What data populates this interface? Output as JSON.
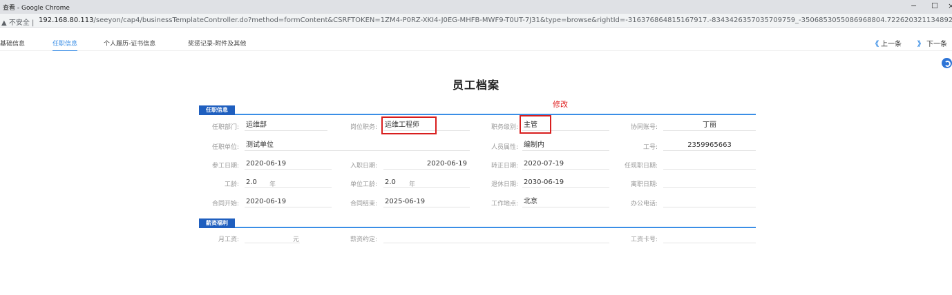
{
  "browser": {
    "window_title": "查看 - Google Chrome",
    "security_label": "不安全",
    "url_host": "192.168.80.113",
    "url_rest": "/seeyon/cap4/businessTemplateController.do?method=formContent&CSRFTOKEN=1ZM4-P0RZ-XKI4-J0EG-MHFB-MWF9-T0UT-7J31&type=browse&rightId=-316376864815167917.-8343426357035709759_-3506853055086968804.722620321134892."
  },
  "tabs": [
    "基础信息",
    "任职信息",
    "个人履历-证书信息",
    "奖惩记录-附件及其他"
  ],
  "active_tab": "任职信息",
  "pager": {
    "prev": "上一条",
    "next": "下一条"
  },
  "form": {
    "title": "员工档案",
    "edit_note": "修改",
    "section_job": "任职信息",
    "section_salary": "薪资福利",
    "fields": {
      "dept_label": "任职部门:",
      "dept": "运维部",
      "position_label": "岗位职务:",
      "position": "运维工程师",
      "level_label": "职务级别:",
      "level": "主管",
      "oa_label": "协同账号:",
      "oa": "丁丽",
      "unit_label": "任职单位:",
      "unit": "测试单位",
      "staff_type_label": "人员属性:",
      "staff_type": "编制内",
      "emp_no_label": "工号:",
      "emp_no": "2359965663",
      "work_start_label": "参工日期:",
      "work_start": "2020-06-19",
      "join_label": "入职日期:",
      "join": "2020-06-19",
      "regular_label": "转正日期:",
      "regular": "2020-07-19",
      "current_label": "任现职日期:",
      "current": "",
      "seniority_label": "工龄:",
      "seniority": "2.0",
      "seniority_unit": "年",
      "unit_seniority_label": "单位工龄:",
      "unit_seniority": "2.0",
      "unit_seniority_unit": "年",
      "retire_label": "退休日期:",
      "retire": "2030-06-19",
      "leave_label": "离职日期:",
      "leave": "",
      "contract_start_label": "合同开始:",
      "contract_start": "2020-06-19",
      "contract_end_label": "合同结束:",
      "contract_end": "2025-06-19",
      "location_label": "工作地点:",
      "location": "北京",
      "phone_label": "办公电话:",
      "phone": "",
      "salary_label": "月工资:",
      "salary": "",
      "salary_unit": "元",
      "salary_agree_label": "薪资约定:",
      "salary_agree": "",
      "card_label": "工资卡号:",
      "card": ""
    }
  },
  "colors": {
    "accent": "#3a8ee6",
    "section_bg": "#1f5fbf",
    "highlight": "#d81e1e"
  }
}
